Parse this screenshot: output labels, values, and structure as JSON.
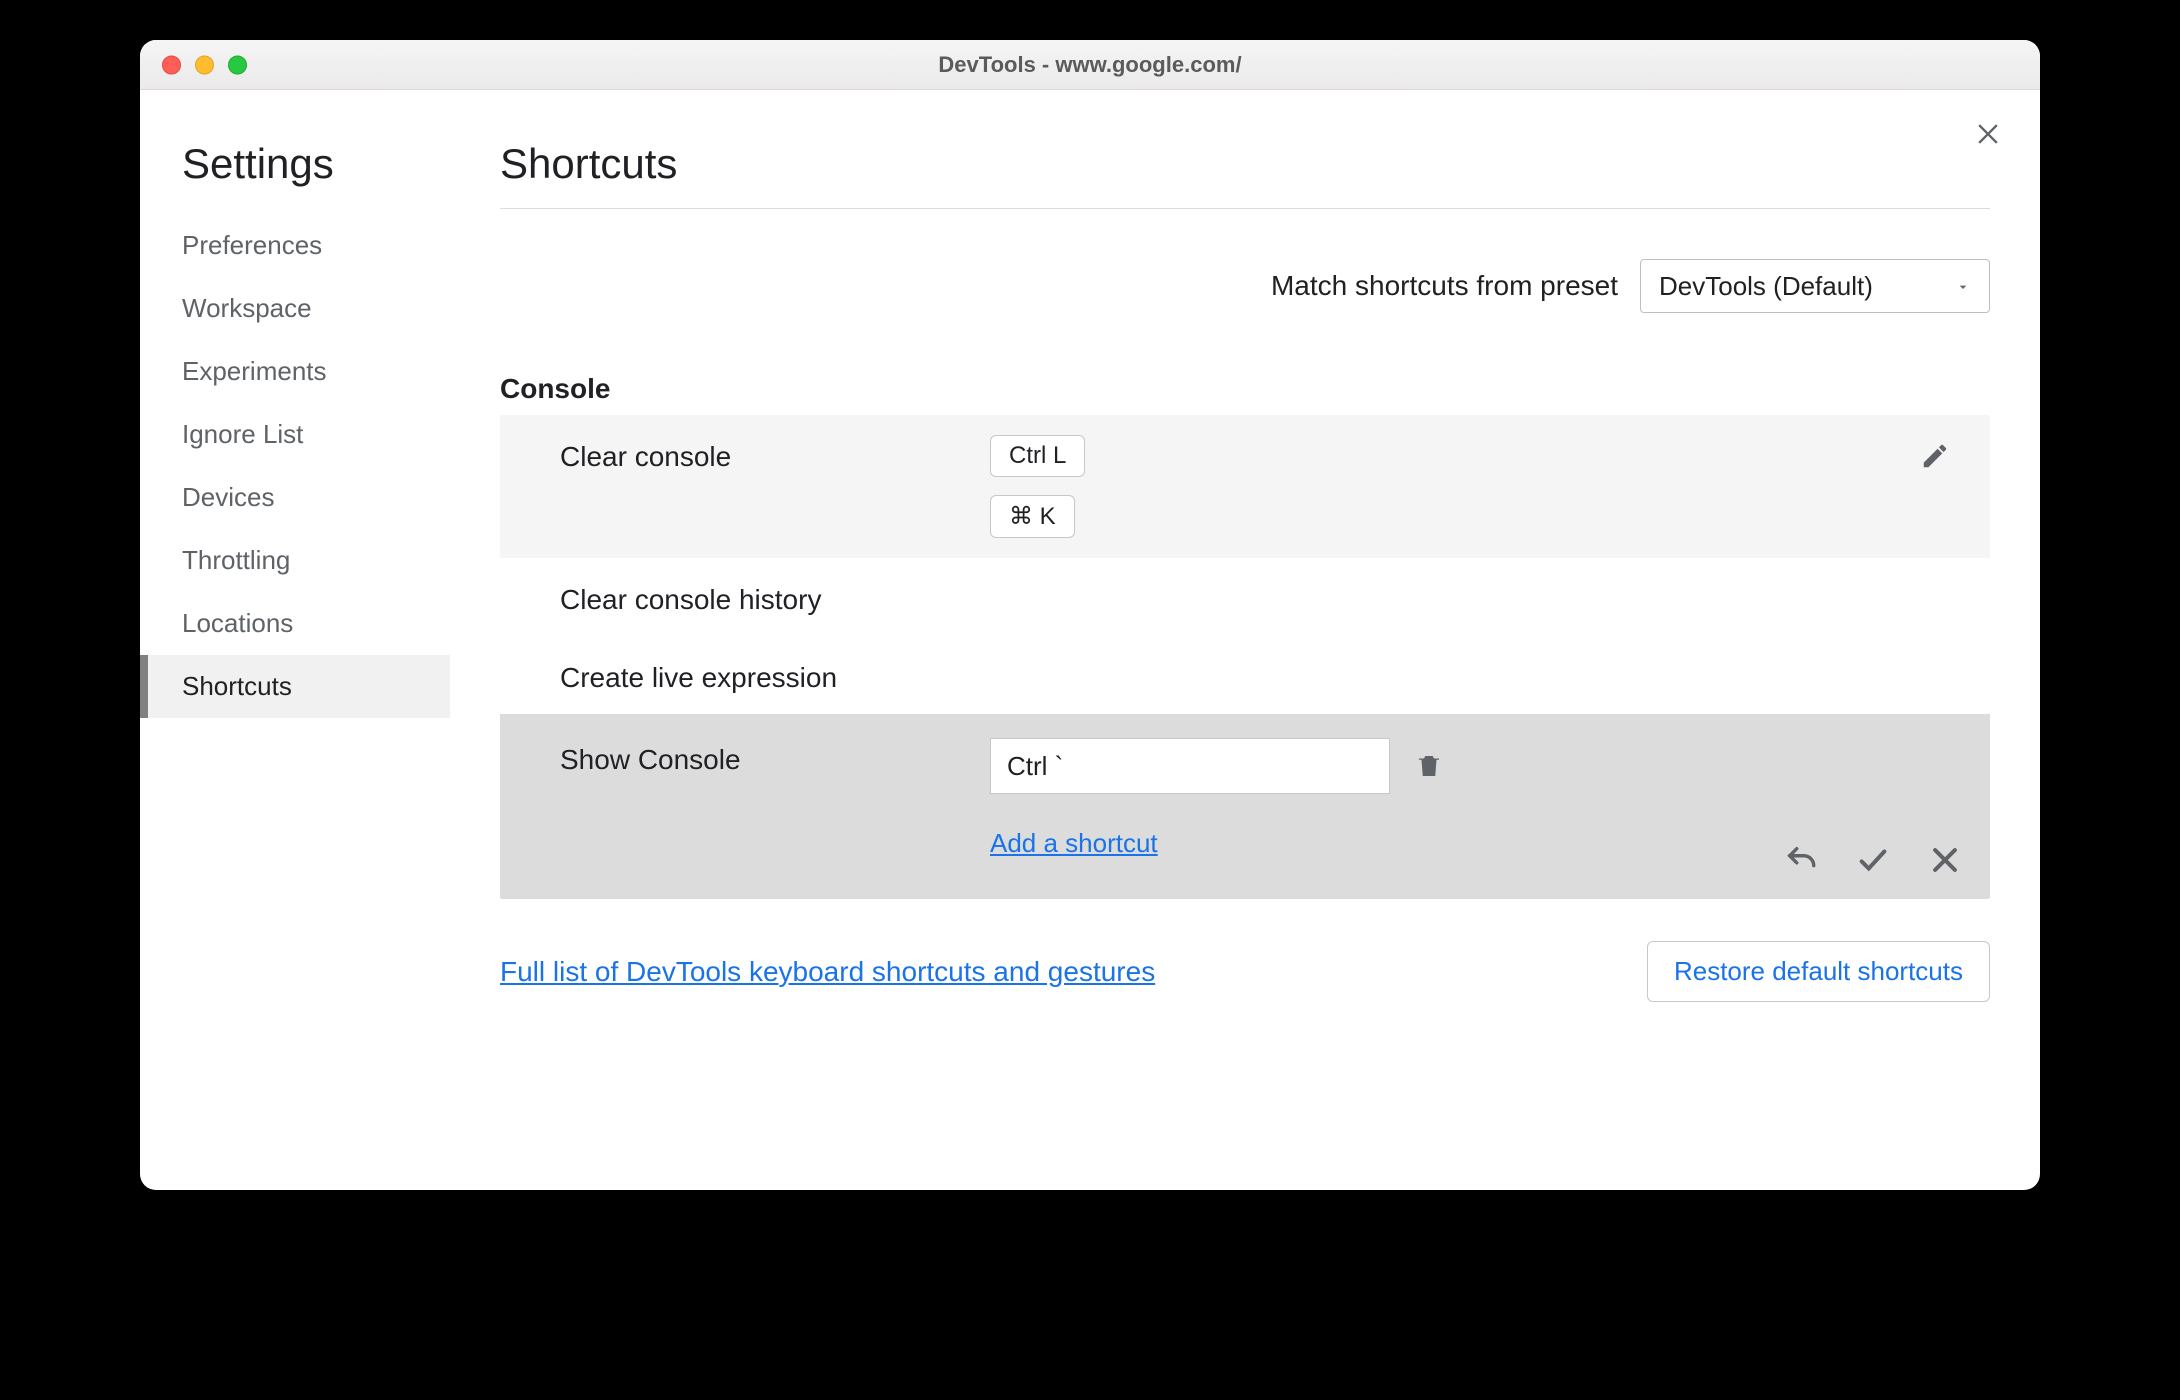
{
  "window": {
    "title": "DevTools - www.google.com/"
  },
  "sidebar": {
    "title": "Settings",
    "items": [
      {
        "label": "Preferences"
      },
      {
        "label": "Workspace"
      },
      {
        "label": "Experiments"
      },
      {
        "label": "Ignore List"
      },
      {
        "label": "Devices"
      },
      {
        "label": "Throttling"
      },
      {
        "label": "Locations"
      },
      {
        "label": "Shortcuts",
        "active": true
      }
    ]
  },
  "page": {
    "title": "Shortcuts",
    "preset_label": "Match shortcuts from preset",
    "preset_value": "DevTools (Default)",
    "section": "Console",
    "rows": {
      "clear_console": {
        "label": "Clear console",
        "key1": "Ctrl L",
        "key2": "⌘ K"
      },
      "clear_history": {
        "label": "Clear console history"
      },
      "create_live": {
        "label": "Create live expression"
      },
      "show_console": {
        "label": "Show Console",
        "input_value": "Ctrl `",
        "add_link": "Add a shortcut"
      }
    },
    "doc_link": "Full list of DevTools keyboard shortcuts and gestures",
    "restore_btn": "Restore default shortcuts"
  }
}
